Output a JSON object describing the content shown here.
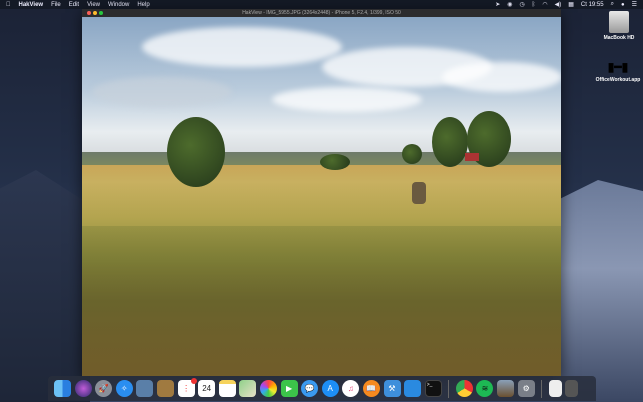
{
  "menubar": {
    "app": "HakView",
    "items": [
      "File",
      "Edit",
      "View",
      "Window",
      "Help"
    ],
    "clock": "Ct 19:55"
  },
  "window": {
    "title": "HakView - IMG_5955.JPG (3264x2448) - iPhone 5, F2.4, 1/399, ISO 50"
  },
  "desktop": [
    {
      "label": "MacBook HD"
    },
    {
      "label": "OfficeWorkout.app"
    }
  ],
  "dock": {
    "reminders_badge": "1",
    "calendar_day": "24"
  },
  "colors": {
    "close": "#fc5f57",
    "minimize": "#fdbc2e",
    "zoom": "#28c840"
  }
}
